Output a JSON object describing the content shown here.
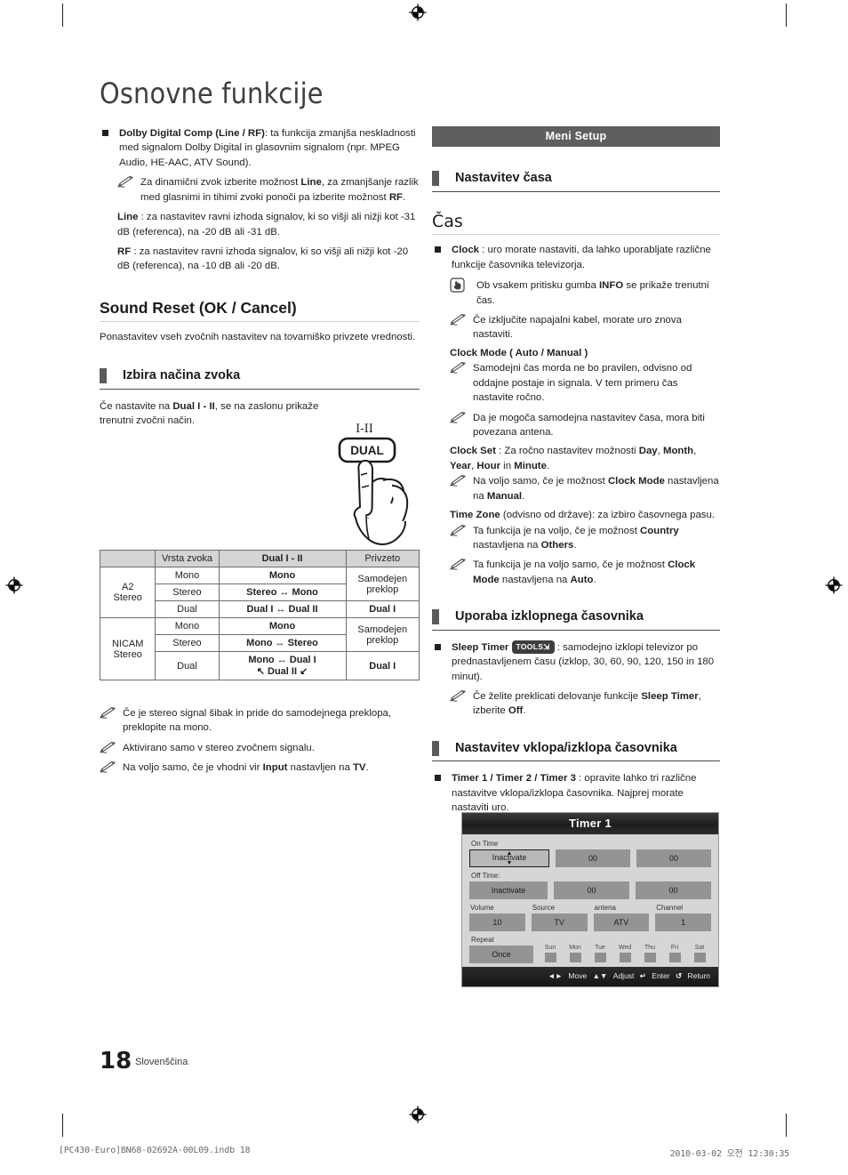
{
  "page": {
    "title": "Osnovne funkcije",
    "number": "18",
    "language": "Slovenščina",
    "print_left": "[PC430-Euro]BN68-02692A-00L09.indb   18",
    "print_right": "2010-03-02   오전 12:30:35"
  },
  "left_column": {
    "dolby": {
      "term": "Dolby Digital Comp (Line / RF)",
      "text": ": ta funkcija zmanjša neskladnosti med signalom Dolby Digital in glasovnim signalom (npr. MPEG Audio, HE-AAC, ATV Sound).",
      "note": {
        "p1": "Za dinamični zvok izberite možnost ",
        "b1": "Line",
        "p2": ", za zmanjšanje razlik med glasnimi in tihimi zvoki ponoči pa izberite možnost ",
        "b2": "RF",
        "p3": "."
      },
      "line_term": "Line",
      "line_text": " : za nastavitev ravni izhoda signalov, ki so višji ali nižji kot -31 dB (referenca), na -20 dB ali -31 dB.",
      "rf_term": "RF",
      "rf_text": " : za nastavitev ravni izhoda signalov, ki so višji ali nižji kot -20 dB (referenca), na -10 dB ali -20 dB."
    },
    "sound_reset": {
      "heading": "Sound Reset (OK / Cancel)",
      "text": "Ponastavitev vseh zvočnih nastavitev na tovarniško privzete vrednosti."
    },
    "sound_mode": {
      "heading": "Izbira načina zvoka",
      "intro_p1": "Če nastavite na ",
      "intro_b": "Dual I - II",
      "intro_p2": ", se na zaslonu prikaže trenutni zvočni način."
    },
    "remote": {
      "mode_label": "I-II",
      "button_label": "DUAL"
    },
    "table": {
      "headers": [
        "",
        "Vrsta zvoka",
        "Dual I - II",
        "Privzeto"
      ],
      "rows": [
        {
          "group": "A2 Stereo",
          "type": "Mono",
          "dual": "Mono",
          "default": "Samodejen preklop"
        },
        {
          "group": "",
          "type": "Stereo",
          "dual": "Stereo ↔ Mono",
          "default": ""
        },
        {
          "group": "",
          "type": "Dual",
          "dual": "Dual I ↔ Dual II",
          "default": "Dual I"
        },
        {
          "group": "NICAM Stereo",
          "type": "Mono",
          "dual": "Mono",
          "default": "Samodejen preklop"
        },
        {
          "group": "",
          "type": "Stereo",
          "dual": "Mono ↔ Stereo",
          "default": ""
        },
        {
          "group": "",
          "type": "Dual",
          "dual": "Mono ↔ Dual I",
          "dual2": "↖ Dual II ↙",
          "default": "Dual I"
        }
      ],
      "group_a2_l1": "A2",
      "group_a2_l2": "Stereo",
      "group_nicam_l1": "NICAM",
      "group_nicam_l2": "Stereo"
    },
    "notes": {
      "n1": "Če je stereo signal šibak in pride do samodejnega preklopa, preklopite na mono.",
      "n2": "Aktivirano samo v stereo zvočnem signalu.",
      "n3_p1": "Na voljo samo, če je vhodni vir ",
      "n3_b1": "Input",
      "n3_p2": " nastavljen na ",
      "n3_b2": "TV",
      "n3_p3": "."
    }
  },
  "right_column": {
    "banner": "Meni Setup",
    "time_setup_heading": "Nastavitev časa",
    "clock_heading": "Čas",
    "clock": {
      "term": "Clock",
      "text": " : uro morate nastaviti, da lahko uporabljate različne funkcije časovnika televizorja.",
      "info_p1": "Ob vsakem pritisku gumba ",
      "info_b": "INFO",
      "info_p2": " se prikaže trenutni čas.",
      "note1": "Če izključite napajalni kabel, morate uro znova nastaviti."
    },
    "clock_mode": {
      "term": "Clock Mode ( Auto / Manual )",
      "note1": "Samodejni čas morda ne bo pravilen, odvisno od oddajne postaje in signala. V tem primeru čas nastavite ročno.",
      "note2": "Da je mogoča samodejna nastavitev časa, mora biti povezana antena."
    },
    "clock_set": {
      "term": "Clock Set",
      "p1": " : Za ročno nastavitev možnosti ",
      "b1": "Day",
      "p2": ", ",
      "b2": "Month",
      "p3": ", ",
      "b3": "Year",
      "p4": ", ",
      "b4": "Hour",
      "p5": " in ",
      "b5": "Minute",
      "p6": ".",
      "note_p1": "Na voljo samo, če je možnost ",
      "note_b1": "Clock Mode",
      "note_p2": " nastavljena na ",
      "note_b2": "Manual",
      "note_p3": "."
    },
    "time_zone": {
      "term": "Time Zone",
      "text": " (odvisno od države): za izbiro časovnega pasu.",
      "note1_p1": "Ta funkcija je na voljo, če je možnost ",
      "note1_b1": "Country",
      "note1_p2": " nastavljena na ",
      "note1_b2": "Others",
      "note1_p3": ".",
      "note2_p1": "Ta funkcija je na voljo samo, če je možnost ",
      "note2_b1": "Clock Mode",
      "note2_p2": " nastavljena na ",
      "note2_b2": "Auto",
      "note2_p3": "."
    },
    "sleep_heading": "Uporaba izklopnega časovnika",
    "sleep": {
      "term": "Sleep Timer",
      "badge": "TOOLS",
      "text": " : samodejno izklopi televizor po prednastavljenem času (izklop, 30, 60, 90, 120, 150 in 180 minut).",
      "note_p1": "Če želite preklicati delovanje funkcije ",
      "note_b1": "Sleep Timer",
      "note_p2": ", izberite ",
      "note_b2": "Off",
      "note_p3": "."
    },
    "timer_heading": "Nastavitev vklopa/izklopa časovnika",
    "timer": {
      "term": "Timer 1 / Timer 2 / Timer 3",
      "text": " : opravite lahko tri različne nastavitve vklopa/izklopa časovnika. Najprej morate nastaviti uro."
    }
  },
  "osd": {
    "title": "Timer 1",
    "on_time_label": "On Time",
    "on_time_value": "Inactivate",
    "on_hour": "00",
    "on_minute": "00",
    "off_time_label": "Off Time:",
    "off_time_value": "Inactivate",
    "off_hour": "00",
    "off_minute": "00",
    "volume_label": "Volume",
    "volume_value": "10",
    "source_label": "Source",
    "source_value": "TV",
    "antenna_label": "antena",
    "antenna_value": "ATV",
    "channel_label": "Channel",
    "channel_value": "1",
    "repeat_label": "Repeat",
    "repeat_value": "Once",
    "days": [
      "Sun",
      "Mon",
      "Tue",
      "Wed",
      "Thu",
      "Fri",
      "Sat"
    ],
    "footer": {
      "move": "Move",
      "adjust": "Adjust",
      "enter": "Enter",
      "return": "Return"
    }
  },
  "colors": {
    "banner_bg": "#5f5f5f",
    "tab_bg": "#5b5b5b",
    "table_header_bg": "#d4d4d4",
    "osd_bg": "#d6d6d6",
    "osd_cell": "#949494",
    "text": "#231f20"
  }
}
